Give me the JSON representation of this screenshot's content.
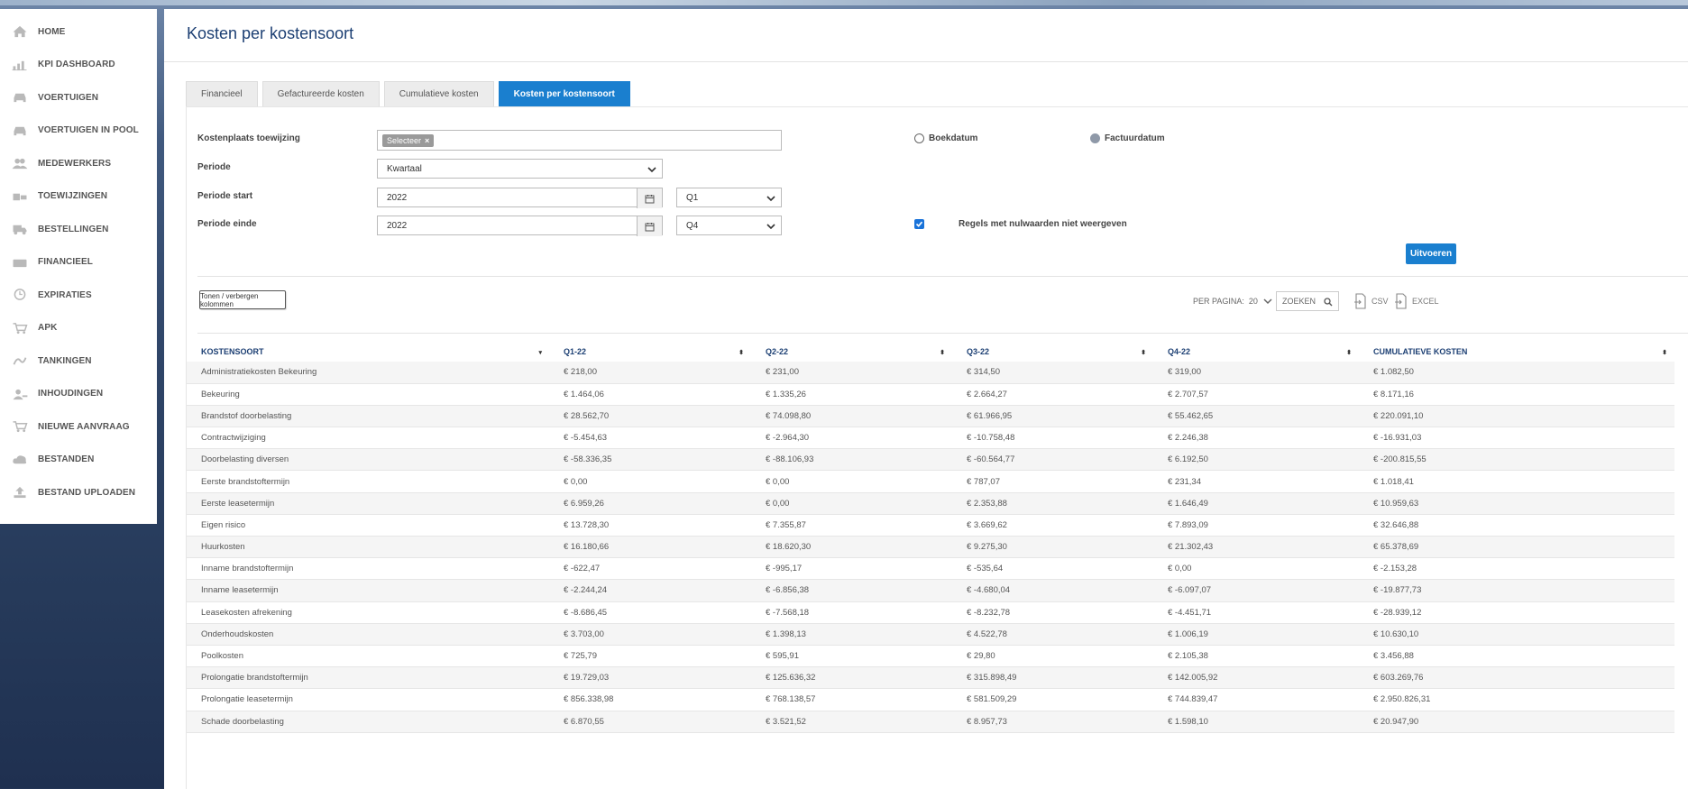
{
  "sidebar": {
    "items": [
      {
        "label": "HOME",
        "icon": "home-icon"
      },
      {
        "label": "KPI DASHBOARD",
        "icon": "chart-icon"
      },
      {
        "label": "VOERTUIGEN",
        "icon": "car-icon"
      },
      {
        "label": "VOERTUIGEN IN POOL",
        "icon": "car-icon"
      },
      {
        "label": "MEDEWERKERS",
        "icon": "users-icon"
      },
      {
        "label": "TOEWIJZINGEN",
        "icon": "assign-icon"
      },
      {
        "label": "BESTELLINGEN",
        "icon": "truck-icon"
      },
      {
        "label": "FINANCIEEL",
        "icon": "money-icon"
      },
      {
        "label": "EXPIRATIES",
        "icon": "clock-icon"
      },
      {
        "label": "APK",
        "icon": "cart-icon"
      },
      {
        "label": "TANKINGEN",
        "icon": "fuel-icon"
      },
      {
        "label": "INHOUDINGEN",
        "icon": "user-minus-icon"
      },
      {
        "label": "NIEUWE AANVRAAG",
        "icon": "cart-icon"
      },
      {
        "label": "BESTANDEN",
        "icon": "cloud-icon"
      },
      {
        "label": "BESTAND UPLOADEN",
        "icon": "upload-icon"
      }
    ]
  },
  "page": {
    "title": "Kosten per kostensoort"
  },
  "tabs": [
    {
      "label": "Financieel",
      "active": false
    },
    {
      "label": "Gefactureerde kosten",
      "active": false
    },
    {
      "label": "Cumulatieve kosten",
      "active": false
    },
    {
      "label": "Kosten per kostensoort",
      "active": true
    }
  ],
  "form": {
    "kostenplaats_label": "Kostenplaats toewijzing",
    "kostenplaats_chip": "Selecteer",
    "periode_label": "Periode",
    "periode_value": "Kwartaal",
    "start_label": "Periode start",
    "start_year": "2022",
    "start_quarter": "Q1",
    "end_label": "Periode einde",
    "end_year": "2022",
    "end_quarter": "Q4",
    "radio_boekdatum": "Boekdatum",
    "radio_factuurdatum": "Factuurdatum",
    "selected_date_type": "Factuurdatum",
    "checkbox_label": "Regels met nulwaarden niet weergeven",
    "checkbox_checked": true,
    "submit_label": "Uitvoeren"
  },
  "toolbar": {
    "toggle_columns_label": "Tonen / verbergen kolommen",
    "per_page_label": "PER PAGINA:",
    "per_page_value": "20",
    "search_placeholder": "ZOEKEN",
    "csv_label": "CSV",
    "excel_label": "EXCEL"
  },
  "table": {
    "headers": [
      "KOSTENSOORT",
      "Q1-22",
      "Q2-22",
      "Q3-22",
      "Q4-22",
      "CUMULATIEVE KOSTEN"
    ],
    "rows": [
      [
        "Administratiekosten Bekeuring",
        "€ 218,00",
        "€ 231,00",
        "€ 314,50",
        "€ 319,00",
        "€ 1.082,50"
      ],
      [
        "Bekeuring",
        "€ 1.464,06",
        "€ 1.335,26",
        "€ 2.664,27",
        "€ 2.707,57",
        "€ 8.171,16"
      ],
      [
        "Brandstof doorbelasting",
        "€ 28.562,70",
        "€ 74.098,80",
        "€ 61.966,95",
        "€ 55.462,65",
        "€ 220.091,10"
      ],
      [
        "Contractwijziging",
        "€ -5.454,63",
        "€ -2.964,30",
        "€ -10.758,48",
        "€ 2.246,38",
        "€ -16.931,03"
      ],
      [
        "Doorbelasting diversen",
        "€ -58.336,35",
        "€ -88.106,93",
        "€ -60.564,77",
        "€ 6.192,50",
        "€ -200.815,55"
      ],
      [
        "Eerste brandstoftermijn",
        "€ 0,00",
        "€ 0,00",
        "€ 787,07",
        "€ 231,34",
        "€ 1.018,41"
      ],
      [
        "Eerste leasetermijn",
        "€ 6.959,26",
        "€ 0,00",
        "€ 2.353,88",
        "€ 1.646,49",
        "€ 10.959,63"
      ],
      [
        "Eigen risico",
        "€ 13.728,30",
        "€ 7.355,87",
        "€ 3.669,62",
        "€ 7.893,09",
        "€ 32.646,88"
      ],
      [
        "Huurkosten",
        "€ 16.180,66",
        "€ 18.620,30",
        "€ 9.275,30",
        "€ 21.302,43",
        "€ 65.378,69"
      ],
      [
        "Inname brandstoftermijn",
        "€ -622,47",
        "€ -995,17",
        "€ -535,64",
        "€ 0,00",
        "€ -2.153,28"
      ],
      [
        "Inname leasetermijn",
        "€ -2.244,24",
        "€ -6.856,38",
        "€ -4.680,04",
        "€ -6.097,07",
        "€ -19.877,73"
      ],
      [
        "Leasekosten afrekening",
        "€ -8.686,45",
        "€ -7.568,18",
        "€ -8.232,78",
        "€ -4.451,71",
        "€ -28.939,12"
      ],
      [
        "Onderhoudskosten",
        "€ 3.703,00",
        "€ 1.398,13",
        "€ 4.522,78",
        "€ 1.006,19",
        "€ 10.630,10"
      ],
      [
        "Poolkosten",
        "€ 725,79",
        "€ 595,91",
        "€ 29,80",
        "€ 2.105,38",
        "€ 3.456,88"
      ],
      [
        "Prolongatie brandstoftermijn",
        "€ 19.729,03",
        "€ 125.636,32",
        "€ 315.898,49",
        "€ 142.005,92",
        "€ 603.269,76"
      ],
      [
        "Prolongatie leasetermijn",
        "€ 856.338,98",
        "€ 768.138,57",
        "€ 581.509,29",
        "€ 744.839,47",
        "€ 2.950.826,31"
      ],
      [
        "Schade doorbelasting",
        "€ 6.870,55",
        "€ 3.521,52",
        "€ 8.957,73",
        "€ 1.598,10",
        "€ 20.947,90"
      ]
    ]
  },
  "colors": {
    "accent": "#1a7fcf",
    "title": "#1c3f73"
  }
}
